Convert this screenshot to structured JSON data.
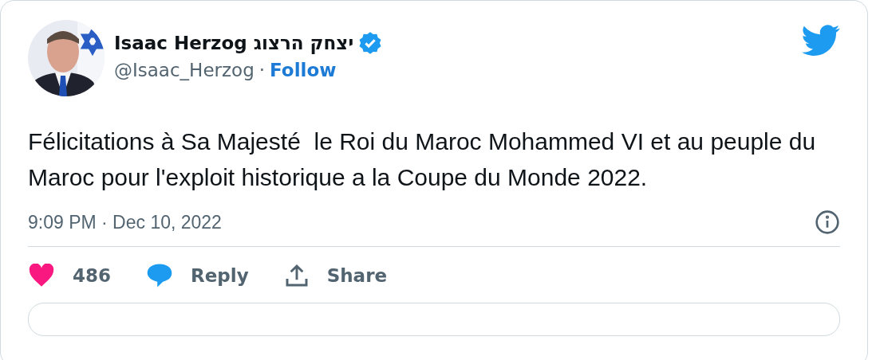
{
  "author": {
    "name": "Isaac Herzog יצחק הרצוג",
    "verified": true,
    "handle": "@Isaac_Herzog",
    "separator": "·",
    "follow": "Follow"
  },
  "text": "Félicitations à Sa Majesté  le Roi du Maroc Mohammed VI et au peuple du Maroc pour l'exploit historique a la Coupe du Monde 2022.",
  "timestamp": "9:09 PM · Dec 10, 2022",
  "actions": [
    {
      "kind": "like",
      "label": "486"
    },
    {
      "kind": "reply",
      "label": "Reply"
    },
    {
      "kind": "share",
      "label": "Share"
    }
  ]
}
